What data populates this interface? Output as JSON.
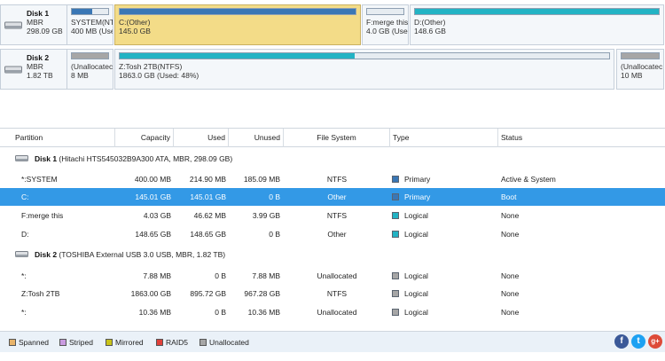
{
  "disks_map": [
    {
      "name": "Disk 1",
      "type": "MBR",
      "size": "298.09 GB",
      "partitions": [
        {
          "label": "SYSTEM(NT",
          "detail": "400 MB (Use",
          "fill": 0.55,
          "color": "#3a77b5"
        },
        {
          "label": "C:(Other)",
          "detail": "145.0 GB",
          "fill": 1.0,
          "color": "#3a77b5",
          "selected": true
        },
        {
          "label": "F:merge this",
          "detail": "4.0 GB (Use",
          "fill": 0.0,
          "color": "#22b3c4"
        },
        {
          "label": "D:(Other)",
          "detail": "148.6 GB",
          "fill": 1.0,
          "color": "#22b3c4"
        }
      ]
    },
    {
      "name": "Disk 2",
      "type": "MBR",
      "size": "1.82 TB",
      "partitions": [
        {
          "label": "(Unallocatec",
          "detail": "8 MB",
          "fill": 1.0,
          "color": "#a6a6a6"
        },
        {
          "label": "Z:Tosh 2TB(NTFS)",
          "detail": "1863.0 GB (Used: 48%)",
          "fill": 0.48,
          "color": "#22b3c4"
        },
        {
          "label": "(Unallocatec",
          "detail": "10 MB",
          "fill": 1.0,
          "color": "#a6a6a6"
        }
      ]
    }
  ],
  "grid": {
    "headers": {
      "partition": "Partition",
      "capacity": "Capacity",
      "used": "Used",
      "unused": "Unused",
      "filesystem": "File System",
      "type": "Type",
      "status": "Status"
    },
    "disk1_header": {
      "name": "Disk 1",
      "detail": "(Hitachi HTS545032B9A300 ATA, MBR, 298.09 GB)"
    },
    "disk1_rows": [
      {
        "partition": "*:SYSTEM",
        "capacity": "400.00 MB",
        "used": "214.90 MB",
        "unused": "185.09 MB",
        "filesystem": "NTFS",
        "type": "Primary",
        "type_color": "#3a77b5",
        "status": "Active & System"
      },
      {
        "partition": "C:",
        "capacity": "145.01 GB",
        "used": "145.01 GB",
        "unused": "0 B",
        "filesystem": "Other",
        "type": "Primary",
        "type_color": "#3a77b5",
        "status": "Boot",
        "selected": true
      },
      {
        "partition": "F:merge this",
        "capacity": "4.03 GB",
        "used": "46.62 MB",
        "unused": "3.99 GB",
        "filesystem": "NTFS",
        "type": "Logical",
        "type_color": "#22b3c4",
        "status": "None"
      },
      {
        "partition": "D:",
        "capacity": "148.65 GB",
        "used": "148.65 GB",
        "unused": "0 B",
        "filesystem": "Other",
        "type": "Logical",
        "type_color": "#22b3c4",
        "status": "None"
      }
    ],
    "disk2_header": {
      "name": "Disk 2",
      "detail": "(TOSHIBA External USB 3.0 USB, MBR, 1.82 TB)"
    },
    "disk2_rows": [
      {
        "partition": "*:",
        "capacity": "7.88 MB",
        "used": "0 B",
        "unused": "7.88 MB",
        "filesystem": "Unallocated",
        "type": "Logical",
        "type_color": "#a6a6a6",
        "status": "None"
      },
      {
        "partition": "Z:Tosh 2TB",
        "capacity": "1863.00 GB",
        "used": "895.72 GB",
        "unused": "967.28 GB",
        "filesystem": "NTFS",
        "type": "Logical",
        "type_color": "#a6a6a6",
        "status": "None"
      },
      {
        "partition": "*:",
        "capacity": "10.36 MB",
        "used": "0 B",
        "unused": "10.36 MB",
        "filesystem": "Unallocated",
        "type": "Logical",
        "type_color": "#a6a6a6",
        "status": "None"
      }
    ]
  },
  "legend": [
    {
      "label": "Spanned",
      "color": "#e8b36a"
    },
    {
      "label": "Striped",
      "color": "#c99be0"
    },
    {
      "label": "Mirrored",
      "color": "#c8c31a"
    },
    {
      "label": "RAID5",
      "color": "#e0403a"
    },
    {
      "label": "Unallocated",
      "color": "#a6a6a6"
    }
  ],
  "social": {
    "facebook": "f",
    "twitter": "t",
    "googleplus": "g+"
  }
}
